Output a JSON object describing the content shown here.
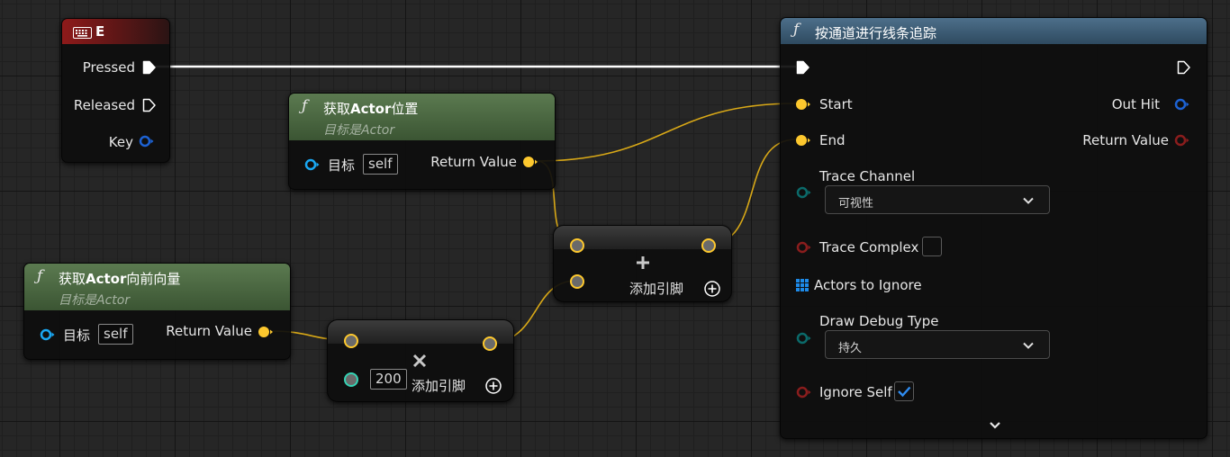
{
  "colors": {
    "exec": "#ffffff",
    "vector": "#fdc82e",
    "struct": "#1d62d3",
    "object": "#1aa7f2",
    "float": "#35d3b4",
    "bool": "#8a1d1d",
    "byte": "#0b6a6a"
  },
  "event_node": {
    "title": "E",
    "icon": "keyboard-icon",
    "pins": {
      "pressed": "Pressed",
      "released": "Released",
      "key": "Key"
    }
  },
  "get_location_node": {
    "title_pre": "获取",
    "title_bold": "Actor",
    "title_post": "位置",
    "subtitle_pre": "目标是",
    "subtitle_italic": "Actor",
    "target_label": "目标",
    "target_value": "self",
    "return_label": "Return Value"
  },
  "get_forward_node": {
    "title_pre": "获取",
    "title_bold": "Actor",
    "title_post": "向前向量",
    "subtitle_pre": "目标是",
    "subtitle_italic": "Actor",
    "target_label": "目标",
    "target_value": "self",
    "return_label": "Return Value"
  },
  "multiply_node": {
    "operator_icon": "multiply-icon",
    "b_value": "200",
    "add_pin_label": "添加引脚"
  },
  "add_node": {
    "operator_icon": "plus-icon",
    "add_pin_label": "添加引脚"
  },
  "trace_node": {
    "title": "按通道进行线条追踪",
    "start_label": "Start",
    "end_label": "End",
    "out_hit_label": "Out Hit",
    "return_label": "Return Value",
    "trace_channel_label": "Trace Channel",
    "trace_channel_value": "可视性",
    "trace_complex_label": "Trace Complex",
    "trace_complex_checked": false,
    "actors_to_ignore_label": "Actors to Ignore",
    "draw_debug_type_label": "Draw Debug Type",
    "draw_debug_type_value": "持久",
    "ignore_self_label": "Ignore Self",
    "ignore_self_checked": true
  }
}
